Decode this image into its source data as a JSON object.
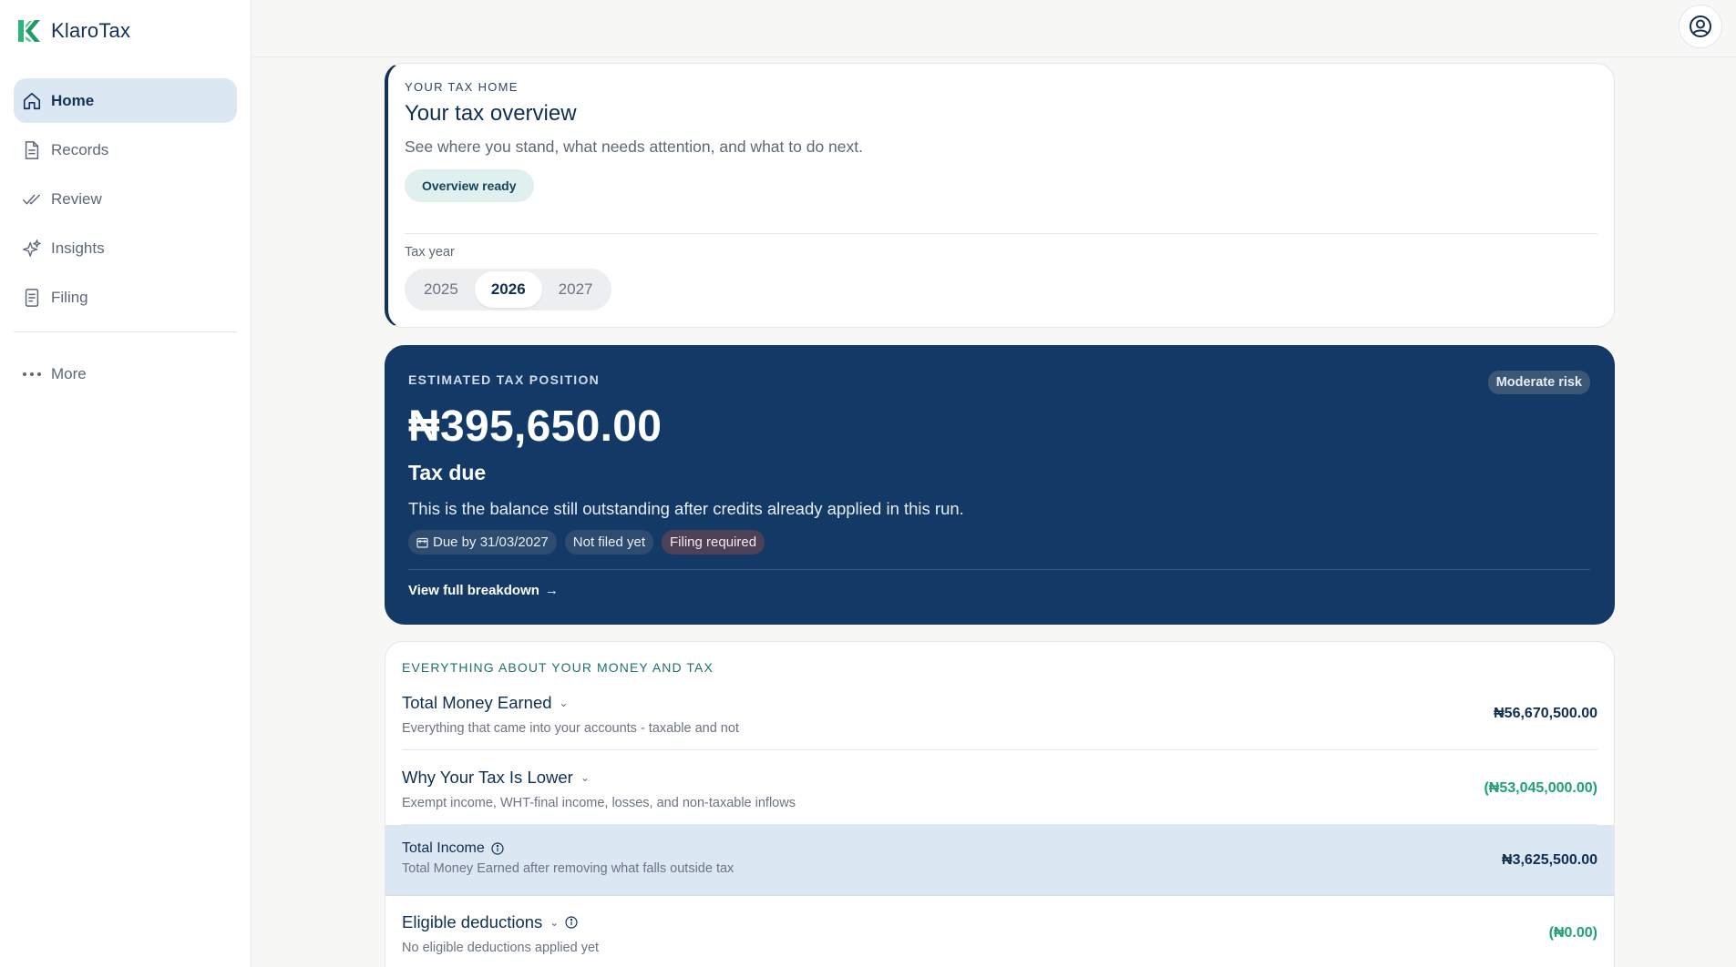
{
  "app": {
    "name": "KlaroTax"
  },
  "sidebar": {
    "items": [
      {
        "label": "Home",
        "icon": "home-icon",
        "active": true
      },
      {
        "label": "Records",
        "icon": "document-icon"
      },
      {
        "label": "Review",
        "icon": "double-check-icon"
      },
      {
        "label": "Insights",
        "icon": "sparkle-icon"
      },
      {
        "label": "Filing",
        "icon": "file-list-icon"
      }
    ],
    "more_label": "More"
  },
  "overview": {
    "eyebrow": "YOUR TAX HOME",
    "title": "Your tax overview",
    "subtitle": "See where you stand, what needs attention, and what to do next.",
    "status_pill": "Overview ready",
    "tax_year_label": "Tax year",
    "years": [
      "2025",
      "2026",
      "2027"
    ],
    "selected_year": "2026"
  },
  "position": {
    "eyebrow": "ESTIMATED TAX POSITION",
    "risk": "Moderate risk",
    "amount": "₦395,650.00",
    "status": "Tax due",
    "description": "This is the balance still outstanding after credits already applied in this run.",
    "chips": {
      "due": "Due by 31/03/2027",
      "filed": "Not filed yet",
      "required": "Filing required"
    },
    "link": "View full breakdown"
  },
  "money": {
    "eyebrow": "EVERYTHING ABOUT YOUR MONEY AND TAX",
    "rows": [
      {
        "title": "Total Money Earned",
        "subtitle": "Everything that came into your accounts - taxable and not",
        "value": "₦56,670,500.00"
      },
      {
        "title": "Why Your Tax Is Lower",
        "subtitle": "Exempt income, WHT-final income, losses, and non-taxable inflows",
        "value": "(₦53,045,000.00)"
      },
      {
        "title": "Total Income",
        "subtitle": "Total Money Earned after removing what falls outside tax",
        "value": "₦3,625,500.00"
      },
      {
        "title": "Eligible deductions",
        "subtitle": "No eligible deductions applied yet",
        "value": "(₦0.00)"
      }
    ]
  },
  "colors": {
    "brand": "#12325a",
    "accent_green": "#1fa07a",
    "position_bg": "#133a66",
    "highlight_row": "#dce7f4"
  }
}
